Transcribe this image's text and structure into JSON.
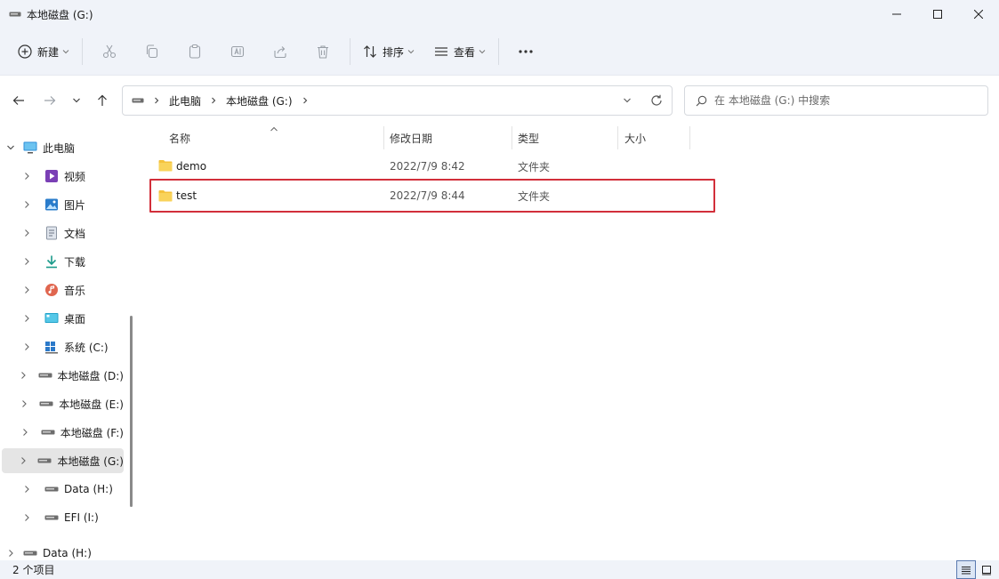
{
  "window": {
    "title": "本地磁盘 (G:)"
  },
  "toolbar": {
    "new_label": "新建",
    "sort_label": "排序",
    "view_label": "查看"
  },
  "breadcrumb": [
    "此电脑",
    "本地磁盘 (G:)"
  ],
  "search": {
    "placeholder": "在 本地磁盘 (G:) 中搜索"
  },
  "sidebar": {
    "items": [
      {
        "label": "此电脑",
        "icon": "monitor-icon",
        "expanded": true
      },
      {
        "label": "视频",
        "icon": "video-icon"
      },
      {
        "label": "图片",
        "icon": "pictures-icon"
      },
      {
        "label": "文档",
        "icon": "document-icon"
      },
      {
        "label": "下载",
        "icon": "download-icon"
      },
      {
        "label": "音乐",
        "icon": "music-icon"
      },
      {
        "label": "桌面",
        "icon": "desktop-icon"
      },
      {
        "label": "系统 (C:)",
        "icon": "windows-drive-icon"
      },
      {
        "label": "本地磁盘 (D:)",
        "icon": "drive-icon"
      },
      {
        "label": "本地磁盘 (E:)",
        "icon": "drive-icon"
      },
      {
        "label": "本地磁盘 (F:)",
        "icon": "drive-icon"
      },
      {
        "label": "本地磁盘 (G:)",
        "icon": "drive-icon",
        "selected": true
      },
      {
        "label": "Data (H:)",
        "icon": "drive-icon"
      },
      {
        "label": "EFI (I:)",
        "icon": "drive-icon"
      },
      {
        "label": "Data (H:)",
        "icon": "drive-icon"
      }
    ]
  },
  "columns": {
    "name": "名称",
    "date": "修改日期",
    "type": "类型",
    "size": "大小"
  },
  "files": [
    {
      "name": "demo",
      "date": "2022/7/9 8:42",
      "type": "文件夹",
      "size": ""
    },
    {
      "name": "test",
      "date": "2022/7/9 8:44",
      "type": "文件夹",
      "size": "",
      "highlighted": true
    }
  ],
  "status": {
    "item_count": "2 个项目"
  },
  "colors": {
    "highlight_border": "#d22f3a",
    "folder": "#f4c23c",
    "selected_bg": "#e5e5e5"
  }
}
